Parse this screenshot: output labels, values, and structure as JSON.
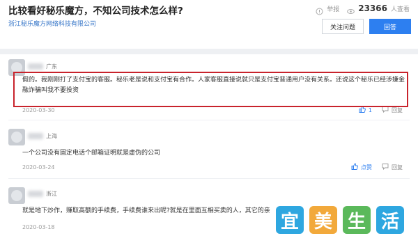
{
  "question": {
    "title": "比较看好秘乐魔方，不知公司技术怎么样?",
    "company": "浙江秘乐魔方网络科技有限公司",
    "meta_label": "举报",
    "view_count": "23366",
    "view_unit": "人查看",
    "follow_label": "关注问题",
    "answer_label": "回答"
  },
  "answers": [
    {
      "location": "广东",
      "text_line1": "假的。我刚刚打了支付宝的客服。秘乐老是说和支付宝有合作。人家客服直接说就只是支付宝普通用户没有关系。还说这个秘乐已经涉嫌金",
      "text_line2": "融诈骗叫我不要投资",
      "date": "2020-03-30",
      "likes": "1",
      "reply_label": "回复"
    },
    {
      "location": "上海",
      "text_line1": "一个公司没有固定电话个邮箱证明就是虚伪的公司",
      "date": "2020-03-24",
      "likes_label": "点赞",
      "reply_label": "回复"
    },
    {
      "location": "浙江",
      "text_line1": "就是地下炒作，赚取高额的手续费，手续费谁来出呢?就是在里面互相买卖的人，其它的亲",
      "date": "2020-03-18"
    }
  ],
  "watermark": {
    "chars": [
      "宜",
      "美",
      "生",
      "活"
    ],
    "colors": [
      "#2ea7e0",
      "#f2a93b",
      "#5bb95b",
      "#2ea7e0"
    ]
  }
}
